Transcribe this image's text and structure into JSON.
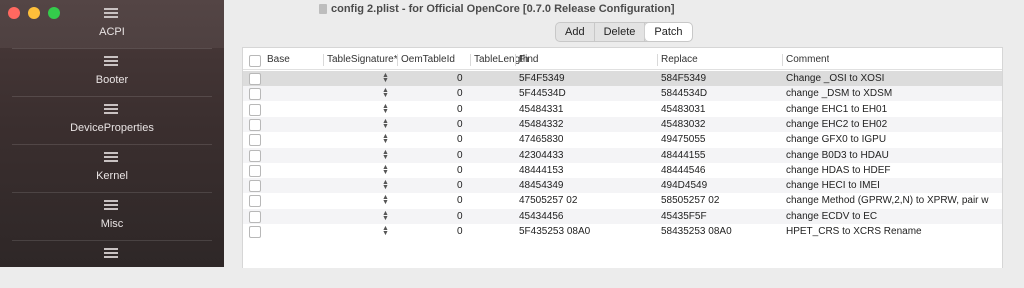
{
  "window": {
    "title": "config 2.plist - for Official OpenCore [0.7.0 Release Configuration]"
  },
  "sidebar": {
    "items": [
      {
        "label": "ACPI",
        "active": true
      },
      {
        "label": "Booter"
      },
      {
        "label": "DeviceProperties"
      },
      {
        "label": "Kernel"
      },
      {
        "label": "Misc"
      },
      {
        "label": ""
      }
    ]
  },
  "toolbar": {
    "add_label": "Add",
    "delete_label": "Delete",
    "patch_label": "Patch"
  },
  "table": {
    "headers": [
      "Base",
      "TableSignature*",
      "OemTableId",
      "TableLength",
      "Find",
      "Replace",
      "Comment"
    ],
    "rows": [
      {
        "length": "0",
        "find": "5F4F5349",
        "replace": "584F5349",
        "comment": "Change _OSI to XOSI"
      },
      {
        "length": "0",
        "find": "5F44534D",
        "replace": "5844534D",
        "comment": "change _DSM to XDSM"
      },
      {
        "length": "0",
        "find": "45484331",
        "replace": "45483031",
        "comment": "change EHC1 to EH01"
      },
      {
        "length": "0",
        "find": "45484332",
        "replace": "45483032",
        "comment": "change EHC2 to EH02"
      },
      {
        "length": "0",
        "find": "47465830",
        "replace": "49475055",
        "comment": "change GFX0 to IGPU"
      },
      {
        "length": "0",
        "find": "42304433",
        "replace": "48444155",
        "comment": "change B0D3 to HDAU"
      },
      {
        "length": "0",
        "find": "48444153",
        "replace": "48444546",
        "comment": "change HDAS to HDEF"
      },
      {
        "length": "0",
        "find": "48454349",
        "replace": "494D4549",
        "comment": "change HECI to IMEI"
      },
      {
        "length": "0",
        "find": "47505257 02",
        "replace": "58505257 02",
        "comment": "change Method (GPRW,2,N) to XPRW, pair w"
      },
      {
        "length": "0",
        "find": "45434456",
        "replace": "45435F5F",
        "comment": "change ECDV to EC"
      },
      {
        "length": "0",
        "find": "5F435253 08A0",
        "replace": "58435253 08A0",
        "comment": "HPET_CRS to XCRS Rename"
      }
    ]
  }
}
